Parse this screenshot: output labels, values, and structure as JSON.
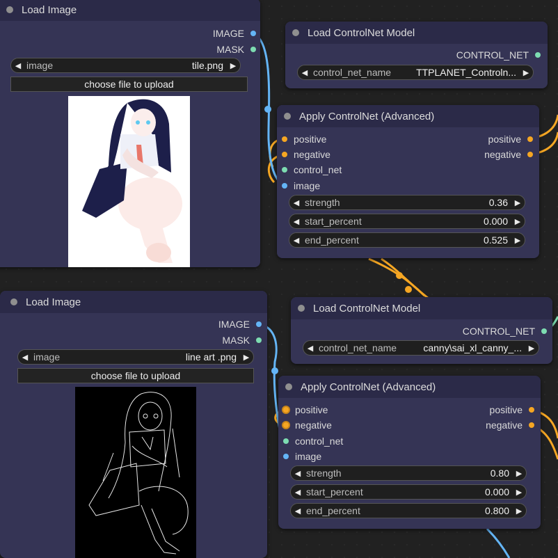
{
  "nodes": {
    "load_image_1": {
      "title": "Load Image",
      "outputs": [
        "IMAGE",
        "MASK"
      ],
      "image_label": "image",
      "image_value": "tile.png",
      "upload_label": "choose file to upload"
    },
    "load_controlnet_1": {
      "title": "Load ControlNet Model",
      "output": "CONTROL_NET",
      "name_label": "control_net_name",
      "name_value": "TTPLANET_Controln..."
    },
    "apply_controlnet_1": {
      "title": "Apply ControlNet (Advanced)",
      "inputs": [
        "positive",
        "negative",
        "control_net",
        "image"
      ],
      "outputs": [
        "positive",
        "negative"
      ],
      "strength_label": "strength",
      "strength_value": "0.36",
      "start_label": "start_percent",
      "start_value": "0.000",
      "end_label": "end_percent",
      "end_value": "0.525"
    },
    "load_image_2": {
      "title": "Load Image",
      "outputs": [
        "IMAGE",
        "MASK"
      ],
      "image_label": "image",
      "image_value": "line art .png",
      "upload_label": "choose file to upload"
    },
    "load_controlnet_2": {
      "title": "Load ControlNet Model",
      "output": "CONTROL_NET",
      "name_label": "control_net_name",
      "name_value": "canny\\sai_xl_canny_..."
    },
    "apply_controlnet_2": {
      "title": "Apply ControlNet (Advanced)",
      "inputs": [
        "positive",
        "negative",
        "control_net",
        "image"
      ],
      "outputs": [
        "positive",
        "negative"
      ],
      "strength_label": "strength",
      "strength_value": "0.80",
      "start_label": "start_percent",
      "start_value": "0.000",
      "end_label": "end_percent",
      "end_value": "0.800"
    }
  },
  "icons": {
    "arrow_left": "left-arrow-icon",
    "arrow_right": "right-arrow-icon",
    "node_dot": "node-status-dot-icon"
  },
  "colors": {
    "image_wire": "#64b5f6",
    "controlnet_wire": "#7ddcb1",
    "conditioning_wire": "#f5a623",
    "node_bg": "#353455",
    "node_header": "#2b2a48",
    "canvas_bg": "#212121"
  }
}
